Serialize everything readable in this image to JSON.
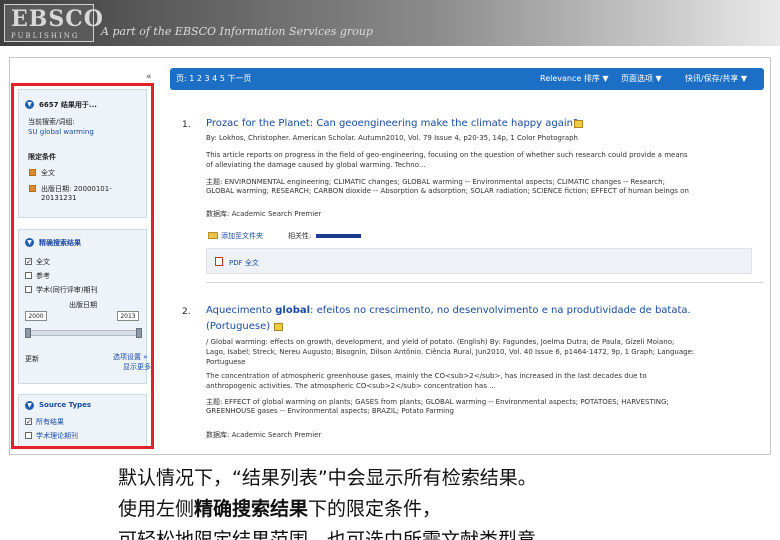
{
  "banner": {
    "logo_name": "EBSCO",
    "logo_sub": "PUBLISHING",
    "tagline": "A part of the EBSCO Information Services group"
  },
  "sidebar": {
    "result_count": "6657 结果用于...",
    "current_search_label": "当前搜索/词组:",
    "current_search_value": "SU global warming",
    "limiters_heading": "限定条件",
    "limiter_1": "全文",
    "limiter_2": "出版日期: 20000101-",
    "limiter_2_cont": "20131231",
    "refine_heading": "精确搜索结果",
    "option_1": "全文",
    "option_2": "参考",
    "option_3": "学术(同行评审)期刊",
    "pub_date_label": "出版日期",
    "date_from": "2000",
    "date_to": "2013",
    "update_label": "更新",
    "show_more": "选项设置 »",
    "show_more_2": "显示更多",
    "source_types_heading": "Source Types",
    "source_all": "所有结果",
    "source_academic": "学术理论期刊"
  },
  "toolbar": {
    "pages": "页: 1 2 3 4 5  下一页",
    "relevance": "Relevance 排序 ▼",
    "page_options": "页面选项 ▼",
    "share": "快讯/保存/共享 ▼"
  },
  "results": [
    {
      "num": "1.",
      "title": "Prozac for the Planet: Can geoengineering make the climate happy again?",
      "byline": "By: Lokhos, Christopher. American Scholar. Autumn2010, Vol. 79 Issue 4, p20-35, 14p, 1 Color Photograph",
      "abstract_1": "This article reports on progress in the field of geo-engineering, focusing on the question of whether such research could provide a means",
      "abstract_2": "of alleviating the damage caused by global warming. Techno...",
      "subjects_1": "主题: ENVIRONMENTAL engineering; CLIMATIC changes; GLOBAL warming -- Environmental aspects; CLIMATIC changes -- Research;",
      "subjects_2": "GLOBAL warming; RESEARCH; CARBON dioxide -- Absorption & adsorption; SOLAR radiation; SCIENCE fiction; EFFECT of human beings on",
      "database": "数据库: Academic Search Premier",
      "add_folder": "添加至文件夹",
      "relevance_label": "相关性:",
      "pdf_label": "PDF 全文"
    },
    {
      "num": "2.",
      "title_pre": "Aquecimento ",
      "title_bold": "global",
      "title_post": ": efeitos no crescimento, no desenvolvimento e na produtividade de batata.",
      "title_lang": "(Portuguese)",
      "line_1": "/ Global warming: effects on growth, development, and yield of potato. (English) By: Fagundes, Joelma Dutra; de Paula, Gizeli Moiano;",
      "line_2": "Lago, Isabel; Streck, Nereu Augusto; Bisognin, Dilson Antônio. Ciência Rural, Jun2010, Vol. 40 Issue 6, p1464-1472, 9p, 1 Graph; Language:",
      "line_3": "Portuguese",
      "line_4": "The concentration of atmospheric greenhouse gases, mainly the CO<sub>2</sub>, has increased in the last decades due to",
      "line_5": "anthropogenic activities. The atmospheric CO<sub>2</sub> concentration has ...",
      "line_6": "主题: EFFECT of global warming on plants; GASES from plants; GLOBAL warming -- Environmental aspects; POTATOES; HARVESTING;",
      "line_7": "GREENHOUSE gases -- Environmental aspects; BRAZIL; Potato Farming",
      "database": "数据库: Academic Search Premier"
    }
  ],
  "caption": {
    "line_1": "默认情况下，“结果列表”中会显示所有检索结果。",
    "line_2_pre": "使用左侧",
    "line_2_bold": "精确搜索结果",
    "line_2_post": "下的限定条件，",
    "line_3": "可轻松地限定结果范围，也可选中所需文献类型意"
  },
  "colors": {
    "highlight_border": "#e2202b",
    "toolbar": "#1d6fc6",
    "link": "#1a4aa0"
  }
}
